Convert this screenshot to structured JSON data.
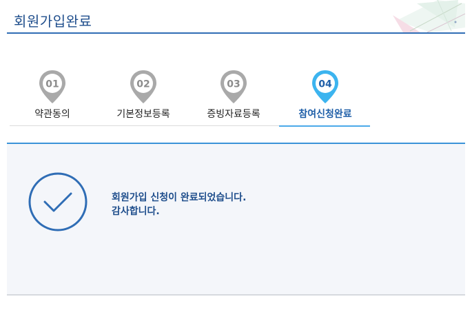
{
  "page": {
    "title": "회원가입완료"
  },
  "steps": [
    {
      "number": "01",
      "label": "약관동의",
      "active": false
    },
    {
      "number": "02",
      "label": "기본정보등록",
      "active": false
    },
    {
      "number": "03",
      "label": "증빙자료등록",
      "active": false
    },
    {
      "number": "04",
      "label": "참여신청완료",
      "active": true
    }
  ],
  "result": {
    "line1": "회원가입 신청이 완료되었습니다.",
    "line2": "감사합니다."
  },
  "colors": {
    "accent": "#2f6db5",
    "active_pin": "#3cb4ef",
    "inactive_pin": "#a9a9a9"
  },
  "icons": [
    "map-pin-icon",
    "checkmark-circle-icon",
    "header-decor"
  ]
}
